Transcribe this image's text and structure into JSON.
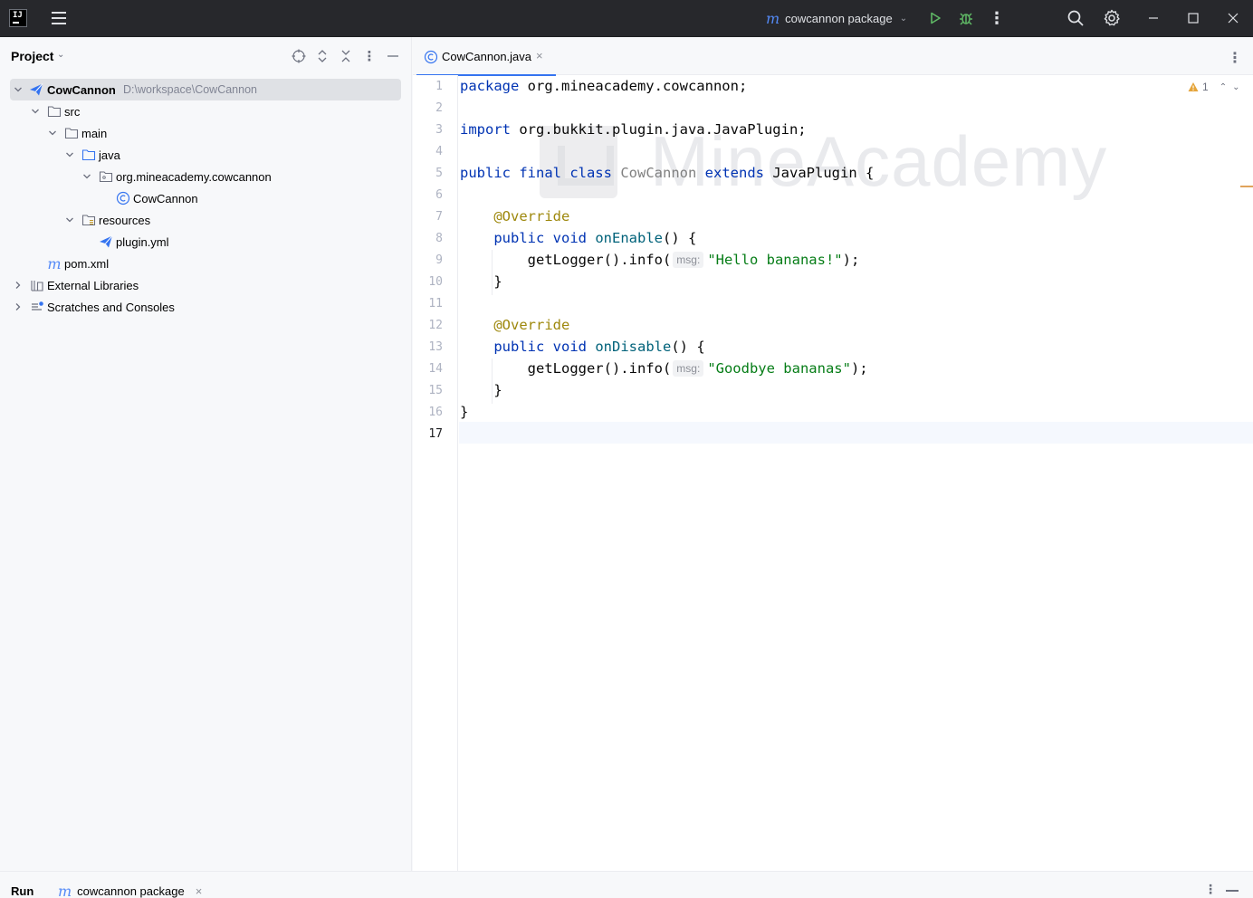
{
  "titlebar": {
    "run_config": "cowcannon package",
    "icons": [
      "app-logo-icon",
      "hamburger-icon",
      "maven-icon",
      "run-icon",
      "debug-icon",
      "more-icon",
      "search-icon",
      "gear-icon",
      "minimize-icon",
      "maximize-icon",
      "close-icon"
    ]
  },
  "project": {
    "title": "Project",
    "tree": [
      {
        "label": "CowCannon",
        "path": "D:\\workspace\\CowCannon",
        "icon": "module-icon",
        "selected": true
      },
      {
        "label": "src",
        "icon": "folder-icon"
      },
      {
        "label": "main",
        "icon": "folder-icon"
      },
      {
        "label": "java",
        "icon": "source-folder-icon"
      },
      {
        "label": "org.mineacademy.cowcannon",
        "icon": "package-icon"
      },
      {
        "label": "CowCannon",
        "icon": "class-icon"
      },
      {
        "label": "resources",
        "icon": "resources-folder-icon"
      },
      {
        "label": "plugin.yml",
        "icon": "plugin-yml-icon"
      },
      {
        "label": "pom.xml",
        "icon": "maven-icon"
      },
      {
        "label": "External Libraries",
        "icon": "libraries-icon"
      },
      {
        "label": "Scratches and Consoles",
        "icon": "scratches-icon"
      }
    ]
  },
  "editor": {
    "tab_label": "CowCannon.java",
    "warning_count": "1",
    "watermark": "MineAcademy",
    "line_numbers": [
      "1",
      "2",
      "3",
      "4",
      "5",
      "6",
      "7",
      "8",
      "9",
      "10",
      "11",
      "12",
      "13",
      "14",
      "15",
      "16",
      "17"
    ],
    "code": {
      "l1_kw": "package",
      "l1_rest": " org.mineacademy.cowcannon;",
      "l3_kw": "import",
      "l3_rest": " org.bukkit.plugin.java.JavaPlugin;",
      "l5_kw1": "public final class",
      "l5_cls": "CowCannon",
      "l5_kw2": "extends",
      "l5_rest": " JavaPlugin {",
      "l7_ann": "@Override",
      "l8_kw": "public void",
      "l8_fn": "onEnable",
      "l8_rest": "() {",
      "l9_pre": "getLogger().info(",
      "l9_hint": "msg:",
      "l9_str": "\"Hello bananas!\"",
      "l9_post": ");",
      "l10": "}",
      "l12_ann": "@Override",
      "l13_kw": "public void",
      "l13_fn": "onDisable",
      "l13_rest": "() {",
      "l14_pre": "getLogger().info(",
      "l14_hint": "msg:",
      "l14_str": "\"Goodbye bananas\"",
      "l14_post": ");",
      "l15": "}",
      "l16": "}"
    }
  },
  "bottom": {
    "run_label": "Run",
    "run_tab": "cowcannon package"
  }
}
